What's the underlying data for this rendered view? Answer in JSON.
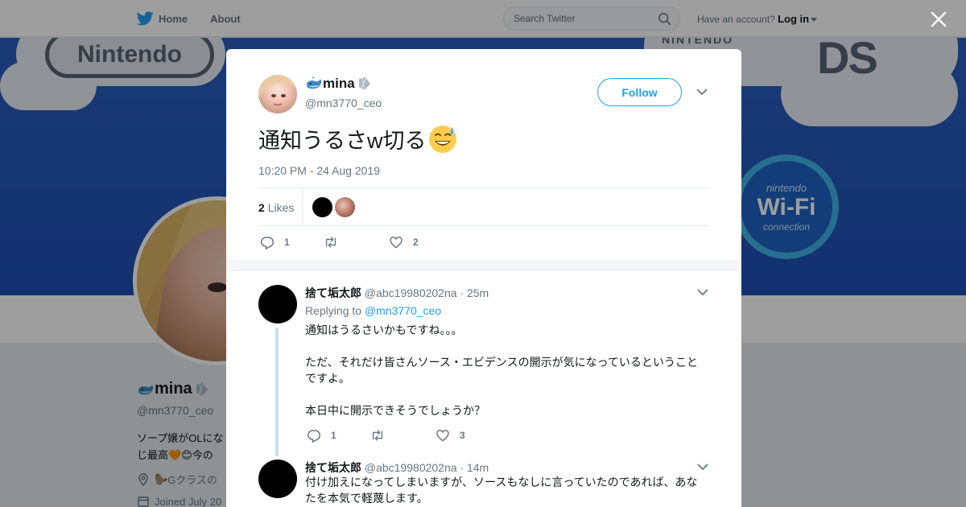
{
  "topbar": {
    "home_label": "Home",
    "about_label": "About",
    "search_placeholder": "Search Twitter",
    "account_prompt": "Have an account?",
    "login_label": "Log in"
  },
  "banner": {
    "nintendo_text": "Nintendo",
    "ds_small_text": "NINTENDO",
    "ds_text": "DS",
    "wifi_top": "nintendo",
    "wifi_main": "Wi-Fi",
    "wifi_bottom": "connection"
  },
  "profile": {
    "name": "mina",
    "handle": "@mn3770_ceo",
    "bio_line1": "ソープ嬢がOLにな",
    "bio_line2": "じ最高",
    "bio_line2_tail": "今の",
    "location": "Gクラスの",
    "joined": "Joined July 20"
  },
  "tweet": {
    "author_name": "mina",
    "author_handle": "@mn3770_ceo",
    "follow_label": "Follow",
    "text": "通知うるさw切る",
    "timestamp": "10:20 PM - 24 Aug 2019",
    "likes_number": "2",
    "likes_label": "Likes",
    "reply_count": "1",
    "retweet_count": "",
    "like_count": "2"
  },
  "replies": [
    {
      "name": "捨て垢太郎",
      "handle": "@abc19980202na",
      "time": "· 25m",
      "replying_prefix": "Replying to",
      "replying_to": "@mn3770_ceo",
      "paragraphs": [
        "通知はうるさいかもですね。。。",
        "ただ、それだけ皆さんソース・エビデンスの開示が気になっているということですよ。",
        "本日中に開示できそうでしょうか？"
      ],
      "reply_count": "1",
      "like_count": "3"
    },
    {
      "name": "捨て垢太郎",
      "handle": "@abc19980202na",
      "time": "· 14m",
      "paragraphs": [
        "付け加えになってしまいますが、ソースもなしに言っていたのであれば、あなたを本気で軽蔑します。"
      ]
    }
  ],
  "colors": {
    "accent": "#1da1f2",
    "banner_blue": "#2a5fc0",
    "thread_line": "#c4dff2"
  },
  "icons": {
    "logo": "twitter-bird-icon",
    "search": "search-icon",
    "close": "close-icon",
    "reply": "reply-icon",
    "retweet": "retweet-icon",
    "like": "heart-icon",
    "more": "chevron-down-icon",
    "name_emoji_1": "whale-emoji-icon",
    "name_emoji_2": "gem-emoji-icon",
    "tweet_emoji": "sweat-smile-emoji-icon"
  }
}
